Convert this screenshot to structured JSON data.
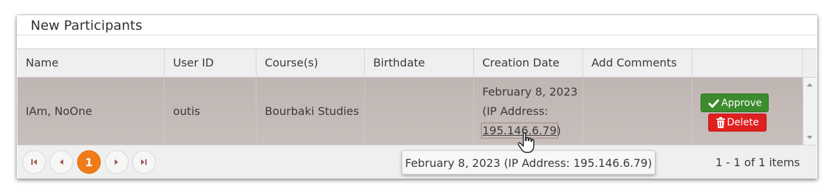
{
  "panel": {
    "title": "New Participants"
  },
  "table": {
    "columns": [
      "Name",
      "User ID",
      "Course(s)",
      "Birthdate",
      "Creation Date",
      "Add Comments",
      ""
    ],
    "rows": [
      {
        "name": "IAm, NoOne",
        "user_id": "outis",
        "courses": "Bourbaki Studies",
        "birthdate": "",
        "creation_date": "February 8, 2023",
        "ip_prefix": "(IP Address:",
        "ip_address": "195.146.6.79",
        "ip_suffix": ")",
        "comments": ""
      }
    ]
  },
  "actions": {
    "approve_label": "Approve",
    "delete_label": "Delete"
  },
  "pager": {
    "first_icon": "first-page-icon",
    "prev_icon": "prev-page-icon",
    "current_page": "1",
    "next_icon": "next-page-icon",
    "last_icon": "last-page-icon",
    "info": "1 - 1 of 1 items"
  },
  "tooltip": {
    "text": "February 8, 2023 (IP Address: 195.146.6.79)"
  },
  "colors": {
    "approve": "#3c8b2e",
    "delete": "#e02020",
    "active_page": "#f07c18",
    "selected_row": "#c4bab7"
  }
}
